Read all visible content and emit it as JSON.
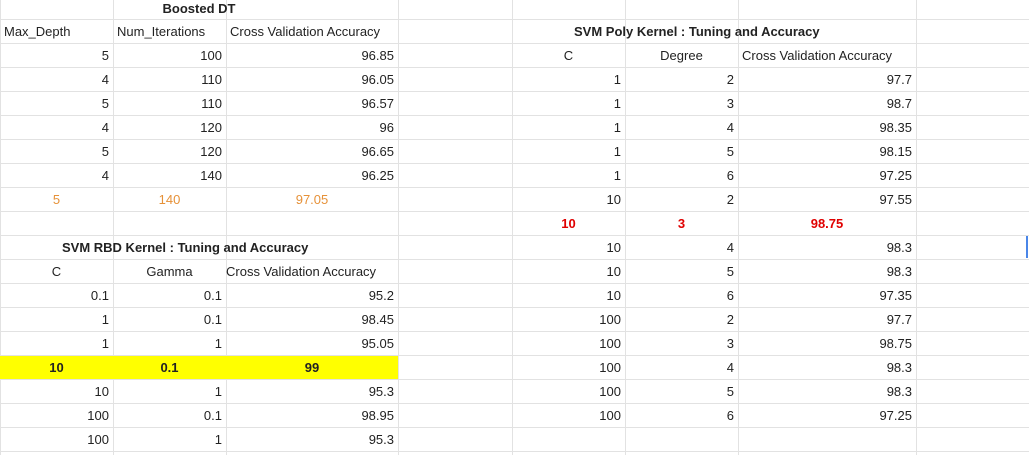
{
  "boosted_dt": {
    "title": "Boosted DT",
    "headers": [
      "Max_Depth",
      "Num_Iterations",
      "Cross Validation Accuracy"
    ],
    "rows": [
      [
        "5",
        "100",
        "96.85"
      ],
      [
        "4",
        "110",
        "96.05"
      ],
      [
        "5",
        "110",
        "96.57"
      ],
      [
        "4",
        "120",
        "96"
      ],
      [
        "5",
        "120",
        "96.65"
      ],
      [
        "4",
        "140",
        "96.25"
      ]
    ],
    "best_row": [
      "5",
      "140",
      "97.05"
    ]
  },
  "svm_rbf": {
    "title": "SVM RBD Kernel : Tuning and Accuracy",
    "headers": [
      "C",
      "Gamma",
      "Cross Validation Accuracy"
    ],
    "rows_before": [
      [
        "0.1",
        "0.1",
        "95.2"
      ],
      [
        "1",
        "0.1",
        "98.45"
      ],
      [
        "1",
        "1",
        "95.05"
      ]
    ],
    "best_row": [
      "10",
      "0.1",
      "99"
    ],
    "rows_after": [
      [
        "10",
        "1",
        "95.3"
      ],
      [
        "100",
        "0.1",
        "98.95"
      ],
      [
        "100",
        "1",
        "95.3"
      ]
    ]
  },
  "svm_poly": {
    "title": "SVM Poly Kernel : Tuning and Accuracy",
    "headers": [
      "C",
      "Degree",
      "Cross Validation Accuracy"
    ],
    "rows_before": [
      [
        "1",
        "2",
        "97.7"
      ],
      [
        "1",
        "3",
        "98.7"
      ],
      [
        "1",
        "4",
        "98.35"
      ],
      [
        "1",
        "5",
        "98.15"
      ],
      [
        "1",
        "6",
        "97.25"
      ],
      [
        "10",
        "2",
        "97.55"
      ]
    ],
    "best_row": [
      "10",
      "3",
      "98.75"
    ],
    "rows_after": [
      [
        "10",
        "4",
        "98.3"
      ],
      [
        "10",
        "5",
        "98.3"
      ],
      [
        "10",
        "6",
        "97.35"
      ],
      [
        "100",
        "2",
        "97.7"
      ],
      [
        "100",
        "3",
        "98.75"
      ],
      [
        "100",
        "4",
        "98.3"
      ],
      [
        "100",
        "5",
        "98.3"
      ],
      [
        "100",
        "6",
        "97.25"
      ]
    ]
  },
  "colors": {
    "highlight": "#ffff00",
    "best_orange": "#e69138",
    "best_red": "#e00000",
    "gridline": "#e2e2e2",
    "active_cell_marker": "#4a86e8"
  }
}
